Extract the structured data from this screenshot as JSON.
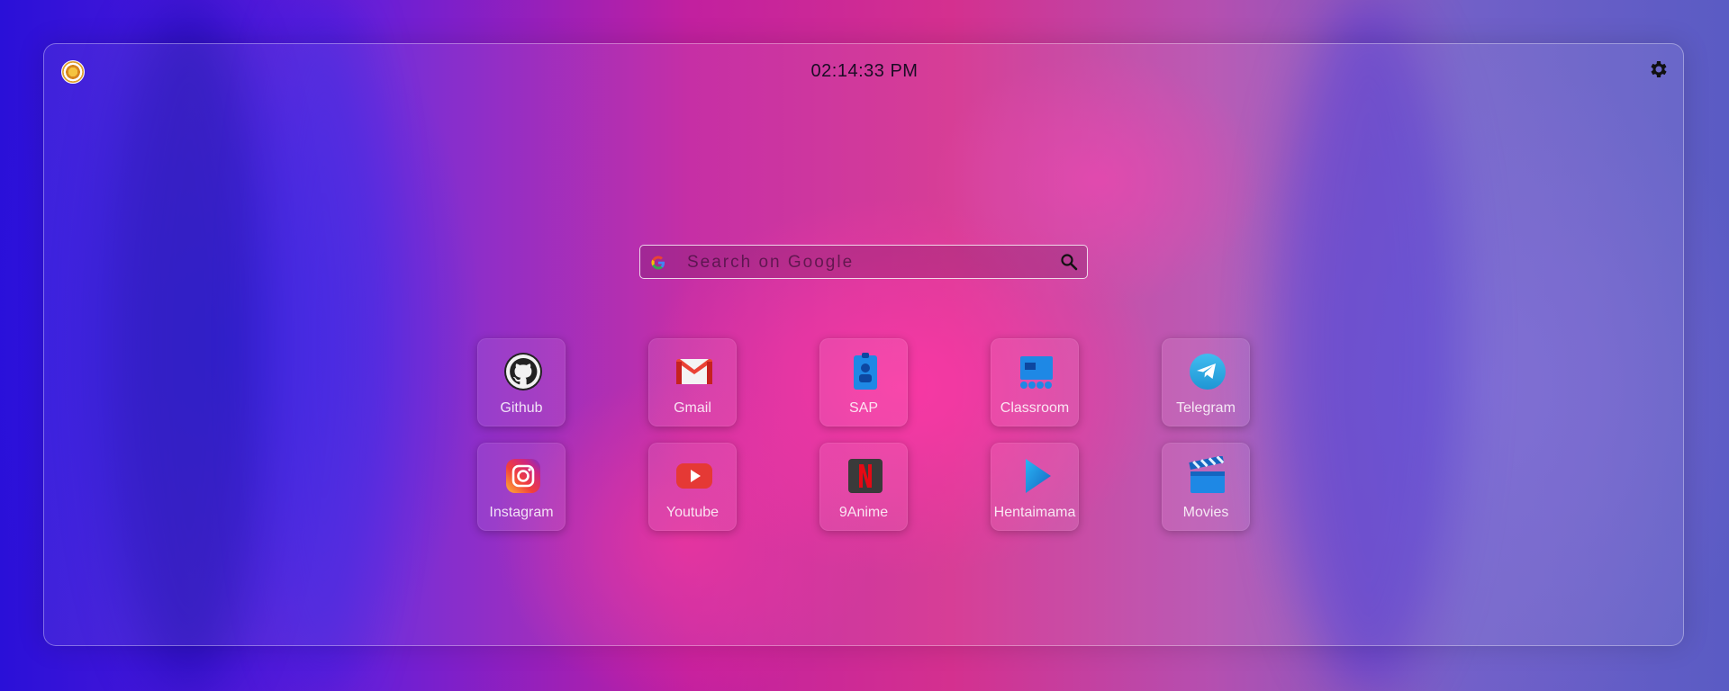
{
  "header": {
    "clock": "02:14:33 PM"
  },
  "search": {
    "placeholder": "Search on Google"
  },
  "shortcuts": [
    {
      "label": "Github",
      "icon": "github-icon"
    },
    {
      "label": "Gmail",
      "icon": "gmail-icon"
    },
    {
      "label": "SAP",
      "icon": "sap-icon"
    },
    {
      "label": "Classroom",
      "icon": "classroom-icon"
    },
    {
      "label": "Telegram",
      "icon": "telegram-icon"
    },
    {
      "label": "Instagram",
      "icon": "instagram-icon"
    },
    {
      "label": "Youtube",
      "icon": "youtube-icon"
    },
    {
      "label": "9Anime",
      "icon": "netflix-icon"
    },
    {
      "label": "Hentaimama",
      "icon": "play-icon"
    },
    {
      "label": "Movies",
      "icon": "clapperboard-icon"
    }
  ],
  "colors": {
    "panel_border": "#ffffff",
    "clock_text": "#1a0c24",
    "tile_label": "#ffffff"
  }
}
